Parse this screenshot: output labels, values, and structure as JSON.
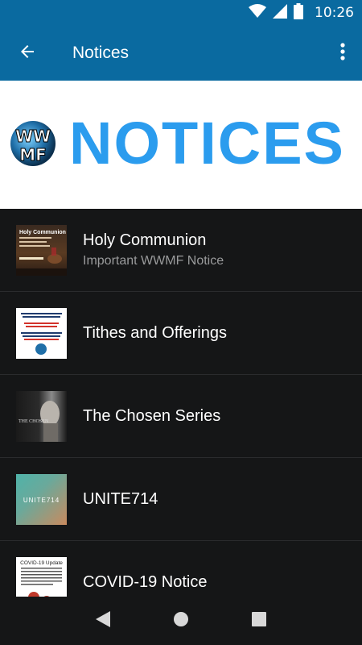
{
  "status_bar": {
    "time": "10:26",
    "icons": [
      "wifi-icon",
      "cell-signal-icon",
      "battery-icon"
    ]
  },
  "app_bar": {
    "title": "Notices",
    "back_icon": "arrow-left-icon",
    "menu_icon": "more-vert-icon"
  },
  "banner": {
    "logo_text": "WWMF",
    "text": "NOTICES"
  },
  "list": {
    "items": [
      {
        "title": "Holy Communion",
        "subtitle": "Important WWMF Notice",
        "thumb_text": "Holy Communion"
      },
      {
        "title": "Tithes and Offerings",
        "subtitle": "",
        "thumb_text": ""
      },
      {
        "title": "The Chosen Series",
        "subtitle": "",
        "thumb_text": "THE CHOSEN"
      },
      {
        "title": "UNITE714",
        "subtitle": "",
        "thumb_text": "UNITE714"
      },
      {
        "title": "COVID-19 Notice",
        "subtitle": "",
        "thumb_text": "COVID-19 Update"
      }
    ]
  },
  "nav_bar": {
    "icons": [
      "back-triangle-icon",
      "home-circle-icon",
      "recents-square-icon"
    ]
  },
  "colors": {
    "primary": "#0a6aa0",
    "banner_text": "#2b9cee",
    "background": "#151617"
  }
}
